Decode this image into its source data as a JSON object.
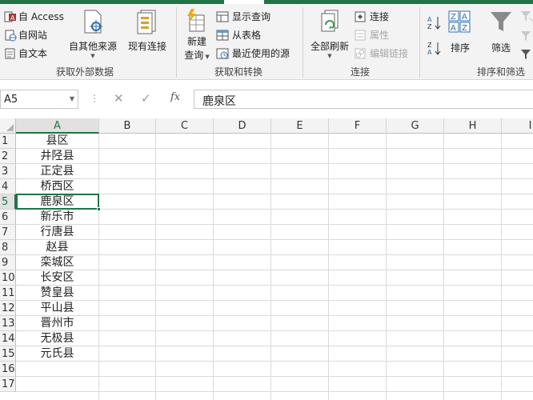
{
  "ribbon": {
    "group_external": {
      "label": "获取外部数据",
      "from_access": "自 Access",
      "from_web": "自网站",
      "from_text": "自文本",
      "from_other": "自其他来源",
      "existing_conn": "现有连接"
    },
    "group_transform": {
      "label": "获取和转换",
      "new_query_line1": "新建",
      "new_query_line2": "查询",
      "show_queries": "显示查询",
      "from_table": "从表格",
      "recent_sources": "最近使用的源"
    },
    "group_connections": {
      "label": "连接",
      "refresh_all": "全部刷新",
      "connections": "连接",
      "properties": "属性",
      "edit_links": "编辑链接"
    },
    "group_sort": {
      "label": "排序和筛选",
      "sort": "排序",
      "filter": "筛选"
    }
  },
  "formula_bar": {
    "name_box": "A5",
    "value": "鹿泉区",
    "cancel_glyph": "✕",
    "enter_glyph": "✓",
    "fx_glyph": "fx"
  },
  "sheet": {
    "columns": [
      "A",
      "B",
      "C",
      "D",
      "E",
      "F",
      "G",
      "H",
      "I"
    ],
    "rows": [
      "1",
      "2",
      "3",
      "4",
      "5",
      "6",
      "7",
      "8",
      "9",
      "10",
      "11",
      "12",
      "13",
      "14",
      "15",
      "16",
      "17"
    ],
    "column_a": [
      "县区",
      "井陉县",
      "正定县",
      "桥西区",
      "鹿泉区",
      "新乐市",
      "行唐县",
      "赵县",
      "栾城区",
      "长安区",
      "赞皇县",
      "平山县",
      "晋州市",
      "无极县",
      "元氏县",
      "",
      ""
    ],
    "active_cell": "A5",
    "accent_color": "#217346"
  }
}
